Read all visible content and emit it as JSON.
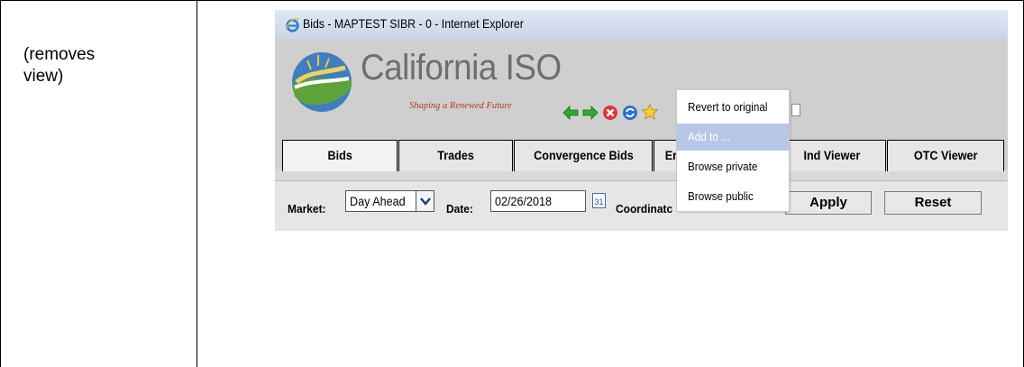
{
  "left_cell": {
    "text": "(removes\nview)"
  },
  "window": {
    "title": "Bids - MAPTEST SIBR - 0 - Internet Explorer"
  },
  "brand": {
    "name": "California ISO",
    "tagline": "Shaping a Renewed Future"
  },
  "nav_icons": [
    "back-arrow-icon",
    "forward-arrow-icon",
    "stop-icon",
    "refresh-icon",
    "favorites-star-icon",
    "document-icon"
  ],
  "tabs": [
    {
      "label": "Bids",
      "active": true
    },
    {
      "label": "Trades",
      "active": false
    },
    {
      "label": "Convergence Bids",
      "active": false
    },
    {
      "label": "Er",
      "active": false
    },
    {
      "label": "Ind Viewer",
      "active": false
    },
    {
      "label": "OTC Viewer",
      "active": false
    }
  ],
  "filters": {
    "market_label": "Market:",
    "market_value": "Day Ahead",
    "date_label": "Date:",
    "date_value": "02/26/2018",
    "calendar_day": "31",
    "coordinator_label": "Coordinatc",
    "apply_label": "Apply",
    "reset_label": "Reset"
  },
  "context_menu": {
    "items": [
      {
        "label": "Revert to original",
        "highlighted": false
      },
      {
        "label": "Add to ...",
        "highlighted": true
      },
      {
        "label": "Browse private",
        "highlighted": false
      },
      {
        "label": "Browse public",
        "highlighted": false
      }
    ]
  },
  "colors": {
    "header_bg": "#cfcfcf",
    "tab_bg": "#e6e6e6",
    "menu_highlight": "#b7c7e6",
    "tagline": "#b33a1f",
    "logo_green": "#6aa63c",
    "logo_blue": "#2e6fb3"
  }
}
